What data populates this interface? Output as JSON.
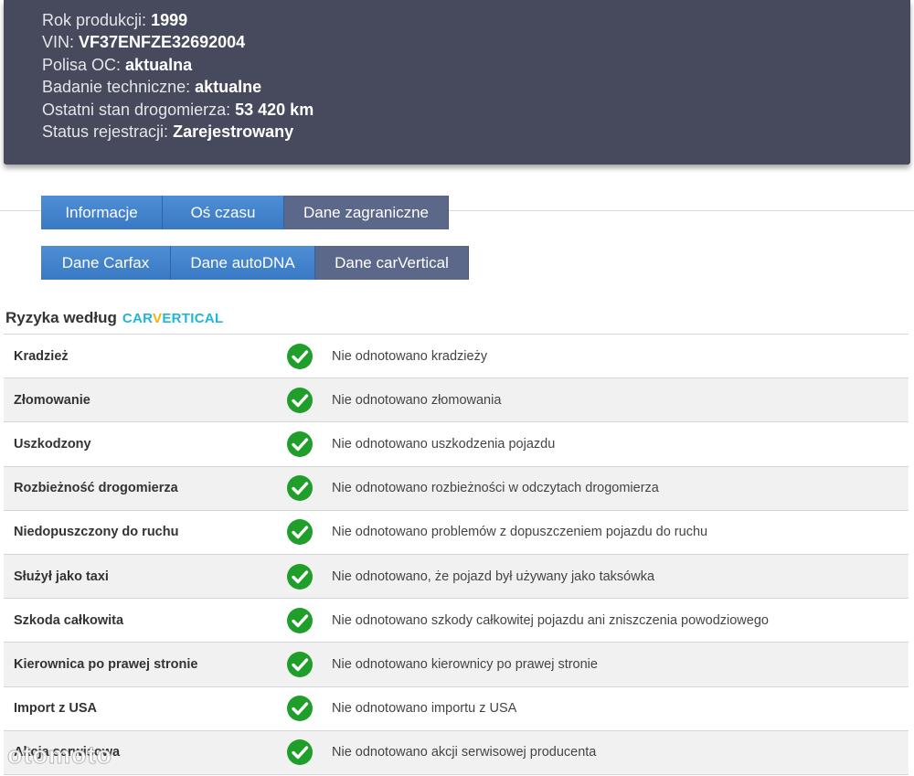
{
  "vehicle_info": [
    {
      "label": "Rok produkcji:",
      "value": "1999"
    },
    {
      "label": "VIN:",
      "value": "VF37ENFZE32692004"
    },
    {
      "label": "Polisa OC:",
      "value": "aktualna"
    },
    {
      "label": "Badanie techniczne:",
      "value": "aktualne"
    },
    {
      "label": "Ostatni stan drogomierza:",
      "value": "53 420 km"
    },
    {
      "label": "Status rejestracji:",
      "value": "Zarejestrowany"
    }
  ],
  "tabs_row1": [
    "Informacje",
    "Oś czasu",
    "Dane zagraniczne"
  ],
  "tabs_row2": [
    "Dane Carfax",
    "Dane autoDNA",
    "Dane carVertical"
  ],
  "section": {
    "title": "Ryzyka według",
    "brand_part1": "CAR",
    "brand_part2": "V",
    "brand_part3": "ERTICAL"
  },
  "risks": [
    {
      "name": "Kradzież",
      "status_icon": "check-circle-icon",
      "description": "Nie odnotowano kradzieży"
    },
    {
      "name": "Złomowanie",
      "status_icon": "check-circle-icon",
      "description": "Nie odnotowano złomowania"
    },
    {
      "name": "Uszkodzony",
      "status_icon": "check-circle-icon",
      "description": "Nie odnotowano uszkodzenia pojazdu"
    },
    {
      "name": "Rozbieżność drogomierza",
      "status_icon": "check-circle-icon",
      "description": "Nie odnotowano rozbieżności w odczytach drogomierza"
    },
    {
      "name": "Niedopuszczony do ruchu",
      "status_icon": "check-circle-icon",
      "description": "Nie odnotowano problemów z dopuszczeniem pojazdu do ruchu"
    },
    {
      "name": "Służył jako taxi",
      "status_icon": "check-circle-icon",
      "description": "Nie odnotowano, że pojazd był używany jako taksówka"
    },
    {
      "name": "Szkoda całkowita",
      "status_icon": "check-circle-icon",
      "description": "Nie odnotowano szkody całkowitej pojazdu ani zniszczenia powodziowego"
    },
    {
      "name": "Kierownica po prawej stronie",
      "status_icon": "check-circle-icon",
      "description": "Nie odnotowano kierownicy po prawej stronie"
    },
    {
      "name": "Import z USA",
      "status_icon": "check-circle-icon",
      "description": "Nie odnotowano importu z USA"
    },
    {
      "name": "Akcja serwisowa",
      "status_icon": "check-circle-icon",
      "description": "Nie odnotowano akcji serwisowej producenta"
    }
  ],
  "watermark": "otomoto",
  "colors": {
    "header_bg": "#474a5c",
    "tab_blue": "#3f7fcb",
    "tab_active": "#5c6889",
    "check_green": "#1f9e2a",
    "brand_cyan": "#1fb7d6",
    "brand_yellow": "#f5b400"
  }
}
